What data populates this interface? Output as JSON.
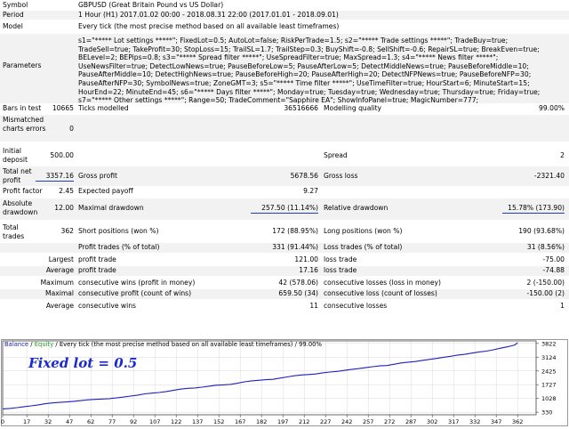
{
  "header": {
    "symbol_label": "Symbol",
    "symbol_value": "GBPUSD (Great Britain Pound vs US Dollar)",
    "period_label": "Period",
    "period_value": "1 Hour (H1) 2017.01.02 00:00 - 2018.08.31 22:00 (2017.01.01 - 2018.09.01)",
    "model_label": "Model",
    "model_value": "Every tick (the most precise method based on all available least timeframes)",
    "parameters_label": "Parameters",
    "parameters_lines": [
      "s1=\"***** Lot settings *****\"; FixedLot=0.5; AutoLot=false; RiskPerTrade=1.5; s2=\"***** Trade settings *****\"; TradeBuy=true;",
      "TradeSell=true; TakeProfit=30; StopLoss=15; TrailSL=1.7; TrailStep=0.3; BuyShift=-0.8; SellShift=-0.6; RepairSL=true; BreakEven=true;",
      "BELevel=2; BEPips=0.8; s3=\"***** Spread filter *****\"; UseSpreadFilter=true; MaxSpread=1.3; s4=\"***** News filter *****\";",
      "UseNewsFilter=true; DetectLowNews=true; PauseBeforeLow=5; PauseAfterLow=5; DetectMiddleNews=true; PauseBeforeMiddle=10;",
      "PauseAfterMiddle=10; DetectHighNews=true; PauseBeforeHigh=20; PauseAfterHigh=20; DetectNFPNews=true; PauseBeforeNFP=30;",
      "PauseAfterNFP=30; SymbolNews=true; ZoneGMT=3; s5=\"***** Time filter *****\"; UseTimeFilter=true; HourStart=6; MinuteStart=15;",
      "HourEnd=22; MinuteEnd=45; s6=\"***** Days filter *****\"; Monday=true; Tuesday=true; Wednesday=true; Thursday=true; Friday=true;",
      "s7=\"***** Other settings *****\"; Range=50; TradeComment=\"Sapphire EA\"; ShowInfoPanel=true; MagicNumber=777;"
    ]
  },
  "stats": {
    "bars_label": "Bars in test",
    "bars_value": "10665",
    "ticks_label": "Ticks modelled",
    "ticks_value": "36516666",
    "quality_label": "Modelling quality",
    "quality_value": "99.00%",
    "mismatch_label": "Mismatched charts errors",
    "mismatch_value": "0",
    "deposit_label": "Initial deposit",
    "deposit_value": "500.00",
    "spread_label": "Spread",
    "spread_value": "2",
    "net_label": "Total net profit",
    "net_value": "3357.16",
    "gross_profit_label": "Gross profit",
    "gross_profit_value": "5678.56",
    "gross_loss_label": "Gross loss",
    "gross_loss_value": "-2321.40",
    "pf_label": "Profit factor",
    "pf_value": "2.45",
    "payoff_label": "Expected payoff",
    "payoff_value": "9.27",
    "abs_dd_label": "Absolute drawdown",
    "abs_dd_value": "12.00",
    "max_dd_label": "Maximal drawdown",
    "max_dd_value": "257.50 (11.14%)",
    "rel_dd_label": "Relative drawdown",
    "rel_dd_value": "15.78% (173.90)",
    "total_trades_label": "Total trades",
    "total_trades_value": "362",
    "short_label": "Short positions (won %)",
    "short_value": "172 (88.95%)",
    "long_label": "Long positions (won %)",
    "long_value": "190 (93.68%)",
    "profit_trades_label": "Profit trades (% of total)",
    "profit_trades_value": "331 (91.44%)",
    "loss_trades_label": "Loss trades (% of total)",
    "loss_trades_value": "31 (8.56%)",
    "largest_label": "Largest",
    "largest_profit_label": "profit trade",
    "largest_profit_value": "121.00",
    "largest_loss_label": "loss trade",
    "largest_loss_value": "-75.00",
    "average_label": "Average",
    "average_profit_label": "profit trade",
    "average_profit_value": "17.16",
    "average_loss_label": "loss trade",
    "average_loss_value": "-74.88",
    "maximum_label": "Maximum",
    "max_cons_wins_label": "consecutive wins (profit in money)",
    "max_cons_wins_value": "42 (578.06)",
    "max_cons_losses_label": "consecutive losses (loss in money)",
    "max_cons_losses_value": "2 (-150.00)",
    "maximal_label": "Maximal",
    "maximal_profit_label": "consecutive profit (count of wins)",
    "maximal_profit_value": "659.50 (34)",
    "maximal_loss_label": "consecutive loss (count of losses)",
    "maximal_loss_value": "-150.00 (2)",
    "avg2_label": "Average",
    "avg_cons_wins_label": "consecutive wins",
    "avg_cons_wins_value": "11",
    "avg_cons_losses_label": "consecutive losses",
    "avg_cons_losses_value": "1"
  },
  "chart_data": {
    "type": "line",
    "legend_balance": "Balance",
    "legend_sep1": " / ",
    "legend_equity": "Equity",
    "legend_rest": " / Every tick (the most precise method based on all available least timeframes) / 99.00%",
    "annotation": "Fixed lot = 0.5",
    "y_ticks": [
      "3822",
      "3124",
      "2425",
      "1727",
      "1028",
      "330"
    ],
    "y_tick_values": [
      3822,
      3124,
      2425,
      1727,
      1028,
      330
    ],
    "x_ticks": [
      "0",
      "17",
      "32",
      "47",
      "62",
      "77",
      "92",
      "107",
      "122",
      "137",
      "152",
      "167",
      "182",
      "197",
      "212",
      "227",
      "242",
      "257",
      "272",
      "287",
      "302",
      "317",
      "332",
      "347",
      "362"
    ],
    "ylim": [
      200,
      3950
    ],
    "xlim": [
      0,
      375
    ],
    "x": [
      0,
      5,
      10,
      15,
      20,
      25,
      30,
      35,
      40,
      45,
      50,
      55,
      60,
      65,
      70,
      75,
      80,
      85,
      90,
      95,
      100,
      105,
      110,
      115,
      120,
      125,
      130,
      135,
      140,
      145,
      150,
      155,
      160,
      165,
      170,
      175,
      180,
      185,
      190,
      195,
      200,
      205,
      210,
      215,
      220,
      225,
      230,
      235,
      240,
      245,
      250,
      255,
      260,
      265,
      270,
      275,
      280,
      285,
      290,
      295,
      300,
      305,
      310,
      315,
      320,
      325,
      330,
      335,
      340,
      345,
      350,
      355,
      360,
      362
    ],
    "series": [
      {
        "name": "Balance",
        "color": "#1f1fbf",
        "values": [
          500,
          520,
          560,
          610,
          650,
          700,
          760,
          800,
          830,
          850,
          880,
          920,
          960,
          980,
          1000,
          1020,
          1060,
          1100,
          1150,
          1200,
          1260,
          1300,
          1330,
          1380,
          1440,
          1500,
          1540,
          1560,
          1600,
          1650,
          1700,
          1720,
          1740,
          1800,
          1870,
          1920,
          1950,
          1980,
          2000,
          2060,
          2120,
          2180,
          2220,
          2240,
          2270,
          2330,
          2370,
          2400,
          2450,
          2500,
          2540,
          2590,
          2640,
          2680,
          2700,
          2760,
          2830,
          2870,
          2900,
          2960,
          3010,
          3060,
          3120,
          3170,
          3230,
          3270,
          3330,
          3390,
          3430,
          3500,
          3580,
          3650,
          3740,
          3857
        ]
      }
    ],
    "accent_color": "#1f3fbf"
  }
}
